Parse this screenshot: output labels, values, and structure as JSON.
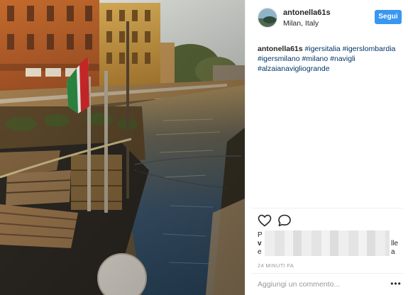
{
  "post": {
    "photo": {
      "description_icon": "canal-photo",
      "colors": {
        "sky": "#dfe4e1",
        "water": "#3d5e78",
        "building_orange": "#c77a3f",
        "building_yellow": "#d6a64e",
        "wall": "#b78e56"
      }
    },
    "header": {
      "username": "antonella61s",
      "location": "Milan, Italy",
      "follow_label": "Segui",
      "follow_color": "#3897f0"
    },
    "caption": {
      "username": "antonella61s",
      "hashtags": [
        "#igersitalia",
        "#igerslombardia",
        "#igersmilano",
        "#milano",
        "#navigli",
        "#alzaianavigliogrande"
      ]
    },
    "actions": {
      "like_icon": "heart-icon",
      "comment_icon": "comment-icon"
    },
    "likes": {
      "line1_start": "P",
      "line2_start": "v",
      "line3_start": "e",
      "line2_end": "lle",
      "line3_end": "a"
    },
    "timestamp": "24 MINUTI FA",
    "comment_box": {
      "placeholder": "Aggiungi un commento...",
      "more_label": "•••"
    }
  }
}
